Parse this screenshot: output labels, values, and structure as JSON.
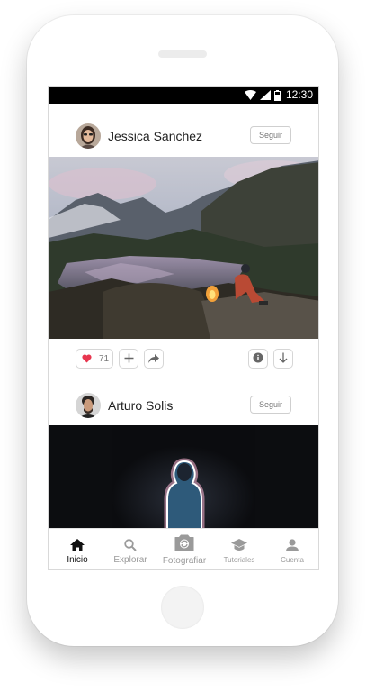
{
  "status_bar": {
    "time": "12:30",
    "icons": [
      "wifi-icon",
      "cellular-signal-icon",
      "battery-icon"
    ]
  },
  "posts": [
    {
      "author": "Jessica Sanchez",
      "follow_label": "Seguir",
      "image": "campfire-mountain-lake-photo",
      "likes": "71",
      "action_icons": [
        "heart-icon",
        "plus-icon",
        "share-icon",
        "info-icon",
        "download-icon"
      ]
    },
    {
      "author": "Arturo Solis",
      "follow_label": "Seguir",
      "image": "neon-silhouette-portrait-photo"
    }
  ],
  "tab_bar": {
    "tabs": [
      {
        "label": "Inicio",
        "icon": "home-icon",
        "active": true
      },
      {
        "label": "Explorar",
        "icon": "search-icon",
        "active": false
      },
      {
        "label": "Fotografiar",
        "icon": "camera-icon",
        "active": false
      },
      {
        "label": "Tutoriales",
        "icon": "graduation-cap-icon",
        "active": false
      },
      {
        "label": "Cuenta",
        "icon": "user-icon",
        "active": false
      }
    ]
  },
  "colors": {
    "heart": "#e8364f",
    "active_tab": "#111111",
    "inactive_tab": "#9a9a9a",
    "status_bar": "#000000"
  }
}
